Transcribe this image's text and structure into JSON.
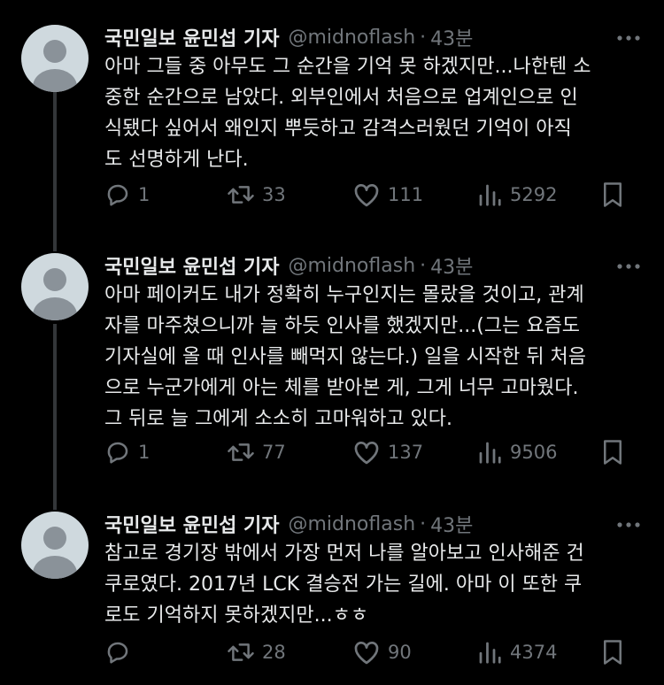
{
  "tweets": [
    {
      "author_name": "국민일보 윤민섭 기자",
      "handle": "@midnoflash",
      "separator": "·",
      "time": "43분",
      "lines": [
        "아마 그들 중 아무도 그 순간을 기억 못 하겠지만...나한텐 소",
        "중한 순간으로 남았다. 외부인에서 처음으로 업계인으로 인",
        "식됐다 싶어서 왜인지 뿌듯하고 감격스러웠던 기억이 아직",
        "도 선명하게 난다."
      ],
      "replies": "1",
      "retweets": "33",
      "likes": "111",
      "views": "5292"
    },
    {
      "author_name": "국민일보 윤민섭 기자",
      "handle": "@midnoflash",
      "separator": "·",
      "time": "43분",
      "lines": [
        "아마 페이커도 내가 정확히 누구인지는 몰랐을 것이고, 관계",
        "자를 마주쳤으니까 늘 하듯 인사를 했겠지만...(그는 요즘도",
        "기자실에 올 때 인사를 빼먹지 않는다.) 일을 시작한 뒤 처음",
        "으로 누군가에게 아는 체를 받아본 게, 그게 너무 고마웠다.",
        "그 뒤로 늘 그에게 소소히 고마워하고 있다."
      ],
      "replies": "1",
      "retweets": "77",
      "likes": "137",
      "views": "9506"
    },
    {
      "author_name": "국민일보 윤민섭 기자",
      "handle": "@midnoflash",
      "separator": "·",
      "time": "43분",
      "lines": [
        "참고로 경기장 밖에서 가장 먼저 나를 알아보고 인사해준 건",
        "쿠로였다. 2017년 LCK 결승전 가는 길에. 아마 이 또한 쿠",
        "로도 기억하지 못하겠지만...ㅎㅎ"
      ],
      "replies": "",
      "retweets": "28",
      "likes": "90",
      "views": "4374"
    }
  ],
  "icons": {
    "reply": "reply-icon",
    "retweet": "retweet-icon",
    "like": "heart-icon",
    "views": "views-icon",
    "bookmark": "bookmark-icon",
    "more": "more-icon",
    "avatar": "default-avatar-icon"
  },
  "colors": {
    "background": "#000000",
    "text": "#e7e9ea",
    "secondary": "#71767b",
    "thread_line": "#333639",
    "avatar_bg": "#cfd9de",
    "avatar_fg": "#8a9299"
  }
}
